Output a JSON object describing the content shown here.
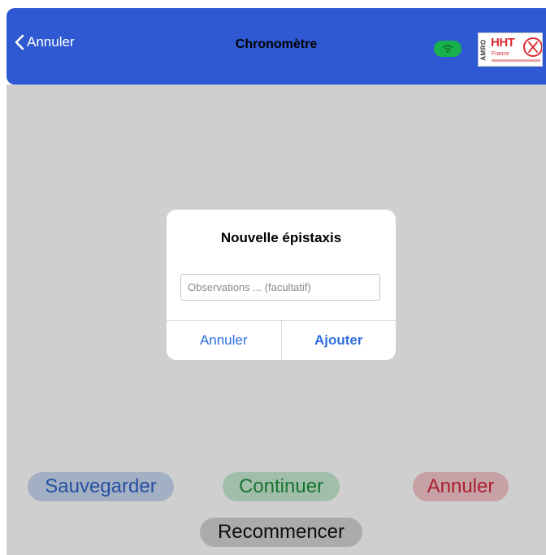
{
  "navbar": {
    "back_label": "Annuler",
    "title": "Chronomètre",
    "status_color": "#18b04d",
    "logo": {
      "side_text": "AMRO",
      "main_text": "HHT",
      "sub_text": "France"
    }
  },
  "actions": {
    "save_label": "Sauvegarder",
    "continue_label": "Continuer",
    "cancel_label": "Annuler",
    "restart_label": "Recommencer"
  },
  "dialog": {
    "title": "Nouvelle épistaxis",
    "input_value": "",
    "input_placeholder": "Observations ... (facultatif)",
    "cancel_label": "Annuler",
    "confirm_label": "Ajouter"
  },
  "colors": {
    "navbar": "#2f59d2",
    "accent_blue": "#2f6ee0",
    "success": "#1f8f3e",
    "danger": "#d0283a"
  }
}
